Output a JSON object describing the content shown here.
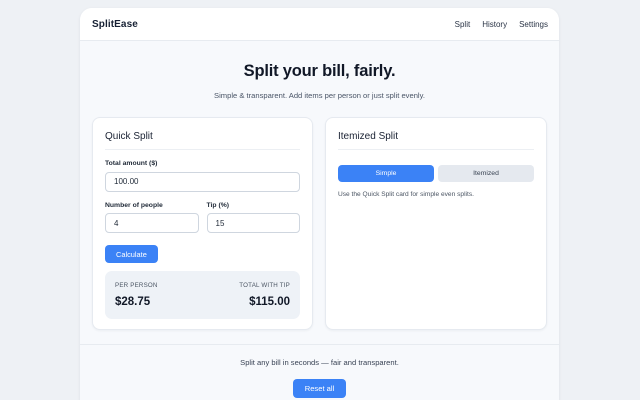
{
  "nav": {
    "brand": "SplitEase",
    "links": [
      "Split",
      "History",
      "Settings"
    ]
  },
  "hero": {
    "title": "Split your bill, fairly.",
    "subtitle": "Simple & transparent. Add items per person or just split evenly."
  },
  "quick_split": {
    "title": "Quick Split",
    "total_label": "Total amount ($)",
    "total_value": "100.00",
    "people_label": "Number of people",
    "people_value": "4",
    "tip_label": "Tip (%)",
    "tip_value": "15",
    "calculate_label": "Calculate",
    "result": {
      "per_person_label": "PER PERSON",
      "per_person_value": "$28.75",
      "total_label": "TOTAL WITH TIP",
      "total_value": "$115.00"
    }
  },
  "itemized_split": {
    "title": "Itemized Split",
    "toggle": [
      "Simple",
      "Itemized"
    ],
    "active_toggle": "Simple",
    "hint": "Use the Quick Split card for simple even splits."
  },
  "footer": {
    "text": "Split any bill in seconds — fair and transparent.",
    "reset_label": "Reset all"
  },
  "colors": {
    "accent": "#3b82f6",
    "background": "#eef1f5"
  }
}
